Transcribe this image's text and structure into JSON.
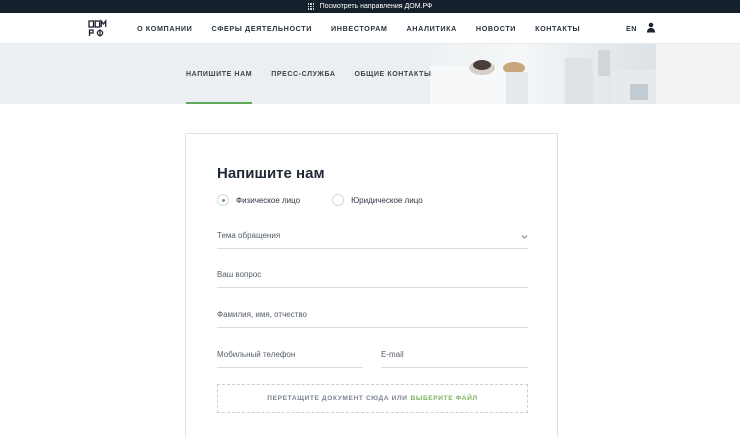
{
  "topbar": {
    "text": "Посмотреть направления ДОМ.РФ",
    "icon": "grid-icon"
  },
  "header": {
    "logo_alt": "ДОМ.РФ",
    "nav": [
      "О КОМПАНИИ",
      "СФЕРЫ ДЕЯТЕЛЬНОСТИ",
      "ИНВЕСТОРАМ",
      "АНАЛИТИКА",
      "НОВОСТИ",
      "КОНТАКТЫ"
    ],
    "lang": "EN",
    "user_icon": "user-icon"
  },
  "subnav": {
    "items": [
      "НАПИШИТЕ НАМ",
      "ПРЕСС-СЛУЖБА",
      "ОБЩИЕ КОНТАКТЫ"
    ],
    "active": 0
  },
  "form": {
    "title": "Напишите нам",
    "radios": [
      {
        "label": "Физическое лицо",
        "checked": true
      },
      {
        "label": "Юридическое лицо",
        "checked": false
      }
    ],
    "fields": {
      "subject": "Тема обращения",
      "question": "Ваш вопрос",
      "fullname": "Фамилия, имя, отчество",
      "phone": "Мобильный телефон",
      "email": "E-mail"
    },
    "dropzone": {
      "text": "ПЕРЕТАЩИТЕ ДОКУМЕНТ СЮДА ИЛИ",
      "link": "ВЫБЕРИТЕ ФАЙЛ"
    }
  },
  "colors": {
    "accent": "#5fa85a",
    "dark": "#14202b"
  }
}
